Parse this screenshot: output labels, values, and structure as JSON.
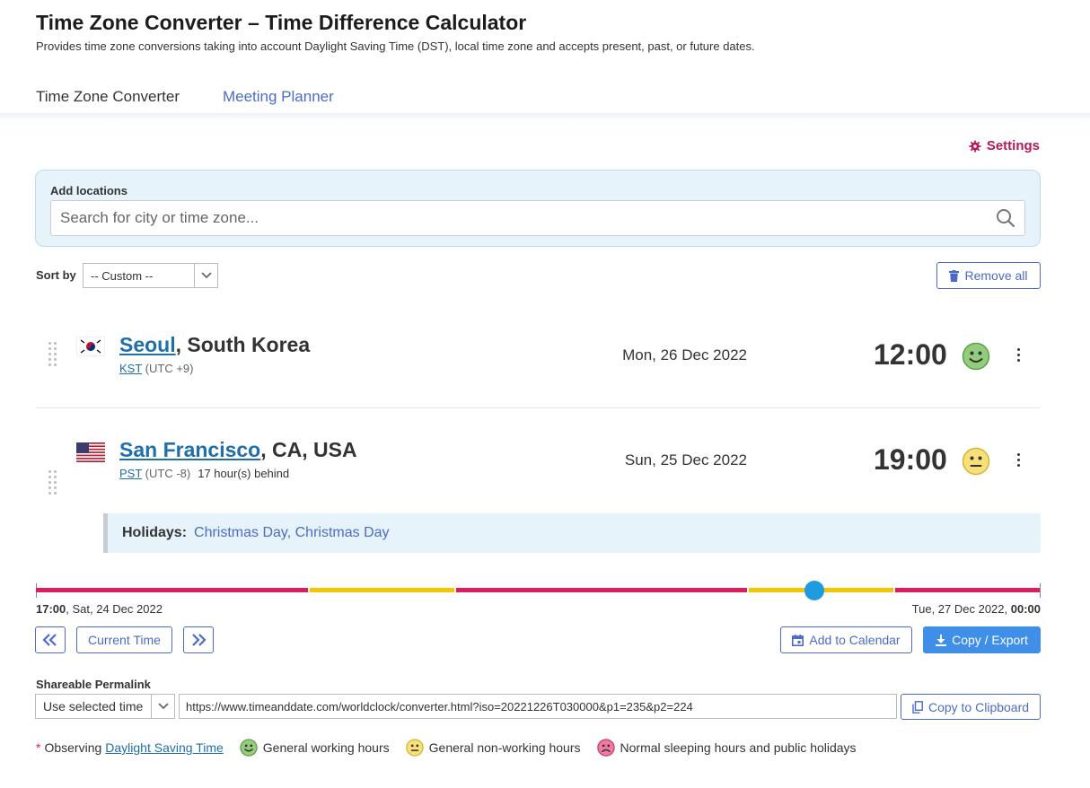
{
  "header": {
    "title": "Time Zone Converter – Time Difference Calculator",
    "subtitle": "Provides time zone conversions taking into account Daylight Saving Time (DST), local time zone and accepts present, past, or future dates."
  },
  "tabs": [
    {
      "label": "Time Zone Converter",
      "active": true
    },
    {
      "label": "Meeting Planner",
      "active": false
    }
  ],
  "settings_label": "Settings",
  "add_locations": {
    "label": "Add locations",
    "placeholder": "Search for city or time zone..."
  },
  "sort": {
    "label": "Sort by",
    "value": "-- Custom --"
  },
  "remove_all_label": "Remove all",
  "locations": [
    {
      "city": "Seoul",
      "region": ", South Korea",
      "tz_abbr": "KST",
      "tz_offset": " (UTC +9)",
      "note": "",
      "date": "Mon, 26 Dec 2022",
      "time": "12:00",
      "status": "working"
    },
    {
      "city": "San Francisco",
      "region": ", CA, USA",
      "tz_abbr": "PST",
      "tz_offset": " (UTC -8)",
      "note": "17 hour(s) behind",
      "date": "Sun, 25 Dec 2022",
      "time": "19:00",
      "status": "non-working"
    }
  ],
  "holidays": {
    "label": "Holidays:",
    "value": "Christmas Day, Christmas Day"
  },
  "timeline": {
    "start_time": "17:00",
    "start_date": ", Sat, 24 Dec 2022",
    "end_date": "Tue, 27 Dec 2022, ",
    "end_time": "00:00",
    "selected_fraction": 0.778
  },
  "controls": {
    "prev_label": "«",
    "current_time_label": "Current Time",
    "next_label": "»",
    "add_calendar_label": "Add to Calendar",
    "copy_export_label": "Copy / Export"
  },
  "permalink": {
    "label": "Shareable Permalink",
    "mode": "Use selected time",
    "url": "https://www.timeanddate.com/worldclock/converter.html?iso=20221226T030000&p1=235&p2=224",
    "copy_label": "Copy to Clipboard"
  },
  "legend": {
    "star": "*",
    "observing": "Observing",
    "dst": "Daylight Saving Time",
    "working": "General working hours",
    "non_working": "General non-working hours",
    "sleeping": "Normal sleeping hours and public holidays"
  },
  "colors": {
    "accent": "#3a7bd5",
    "link": "#1f6fa8",
    "settings": "#b3195a",
    "timeline_red": "#de1b5e",
    "timeline_yellow": "#f5c400",
    "knob": "#1f9be0"
  }
}
